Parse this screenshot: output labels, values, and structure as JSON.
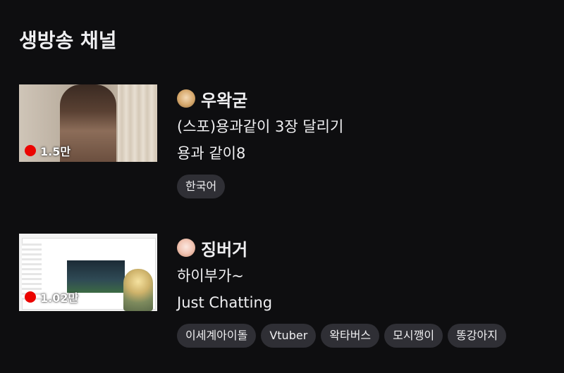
{
  "section": {
    "title": "생방송 채널"
  },
  "channels": [
    {
      "streamer": "우왁굳",
      "avatar_icon": "streamer-avatar",
      "title": "(스포)용과같이 3장 달리기",
      "category": "용과 같이8",
      "viewers": "1.5만",
      "live_color": "#eb0400",
      "tags": [
        "한국어"
      ]
    },
    {
      "streamer": "징버거",
      "avatar_icon": "streamer-avatar",
      "title": "하이부가~",
      "category": "Just Chatting",
      "viewers": "1.02만",
      "live_color": "#eb0400",
      "tags": [
        "이세계아이돌",
        "Vtuber",
        "왁타버스",
        "모시깽이",
        "똥강아지"
      ]
    }
  ],
  "colors": {
    "background": "#0e0e10",
    "tag_background": "#2f2f35",
    "text": "#efeff1"
  }
}
